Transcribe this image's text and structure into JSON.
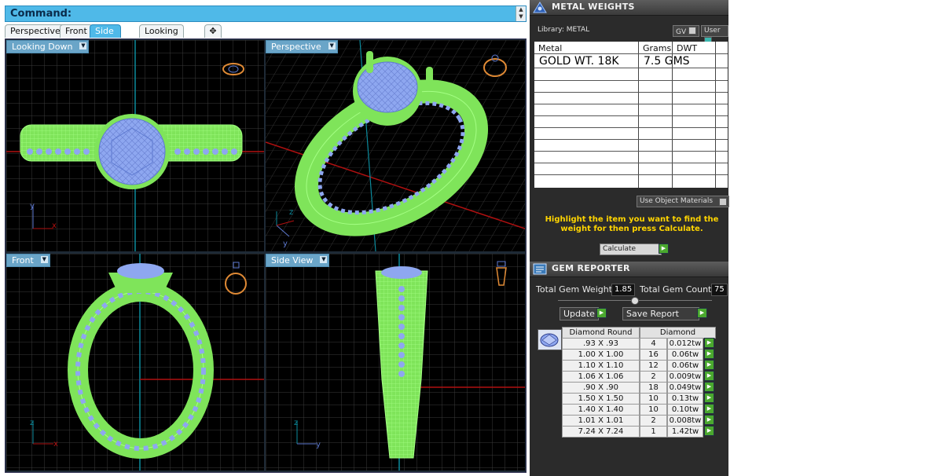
{
  "command": {
    "label": "Command:"
  },
  "tabs": [
    "Perspective",
    "Front",
    "Side View",
    "Looking Down"
  ],
  "viewports": {
    "top_left": "Looking Down",
    "top_right": "Perspective",
    "bottom_left": "Front",
    "bottom_right": "Side View"
  },
  "axis_labels": {
    "x": "x",
    "y": "y",
    "z": "z"
  },
  "metal_weights": {
    "title": "METAL WEIGHTS",
    "library_label": "Library: METAL",
    "gv_label": "GV",
    "user_label": "User",
    "columns": [
      "Metal",
      "Grams",
      "DWT"
    ],
    "row": {
      "metal": "GOLD WT. 18K",
      "grams": "7.5 GMS",
      "dwt": ""
    },
    "use_object_materials": "Use Object Materials",
    "hint": "Highlight the item you want to find the weight for then press Calculate.",
    "calculate_label": "Calculate"
  },
  "gem_reporter": {
    "title": "GEM REPORTER",
    "total_weight_label": "Total Gem Weight",
    "total_weight": "1.85",
    "total_count_label": "Total Gem Count",
    "total_count": "75",
    "update_label": "Update",
    "save_report_label": "Save Report",
    "header_shape": "Diamond Round",
    "header_stone": "Diamond",
    "rows": [
      {
        "size": ".93 X .93",
        "count": "4",
        "tw": "0.012tw"
      },
      {
        "size": "1.00 X 1.00",
        "count": "16",
        "tw": "0.06tw"
      },
      {
        "size": "1.10 X 1.10",
        "count": "12",
        "tw": "0.06tw"
      },
      {
        "size": "1.06 X 1.06",
        "count": "2",
        "tw": "0.009tw"
      },
      {
        "size": ".90 X .90",
        "count": "18",
        "tw": "0.049tw"
      },
      {
        "size": "1.50 X 1.50",
        "count": "10",
        "tw": "0.13tw"
      },
      {
        "size": "1.40 X 1.40",
        "count": "10",
        "tw": "0.10tw"
      },
      {
        "size": "1.01 X 1.01",
        "count": "2",
        "tw": "0.008tw"
      },
      {
        "size": "7.24 X 7.24",
        "count": "1",
        "tw": "1.42tw"
      }
    ]
  },
  "colors": {
    "command_bar": "#4fb9e8",
    "wire_green": "#8cf06a",
    "gem_blue": "#8ea7f0",
    "hint_yellow": "#ffd500"
  },
  "icons": [
    "metal-weights-icon",
    "gem-reporter-icon",
    "gem-preview-icon"
  ]
}
